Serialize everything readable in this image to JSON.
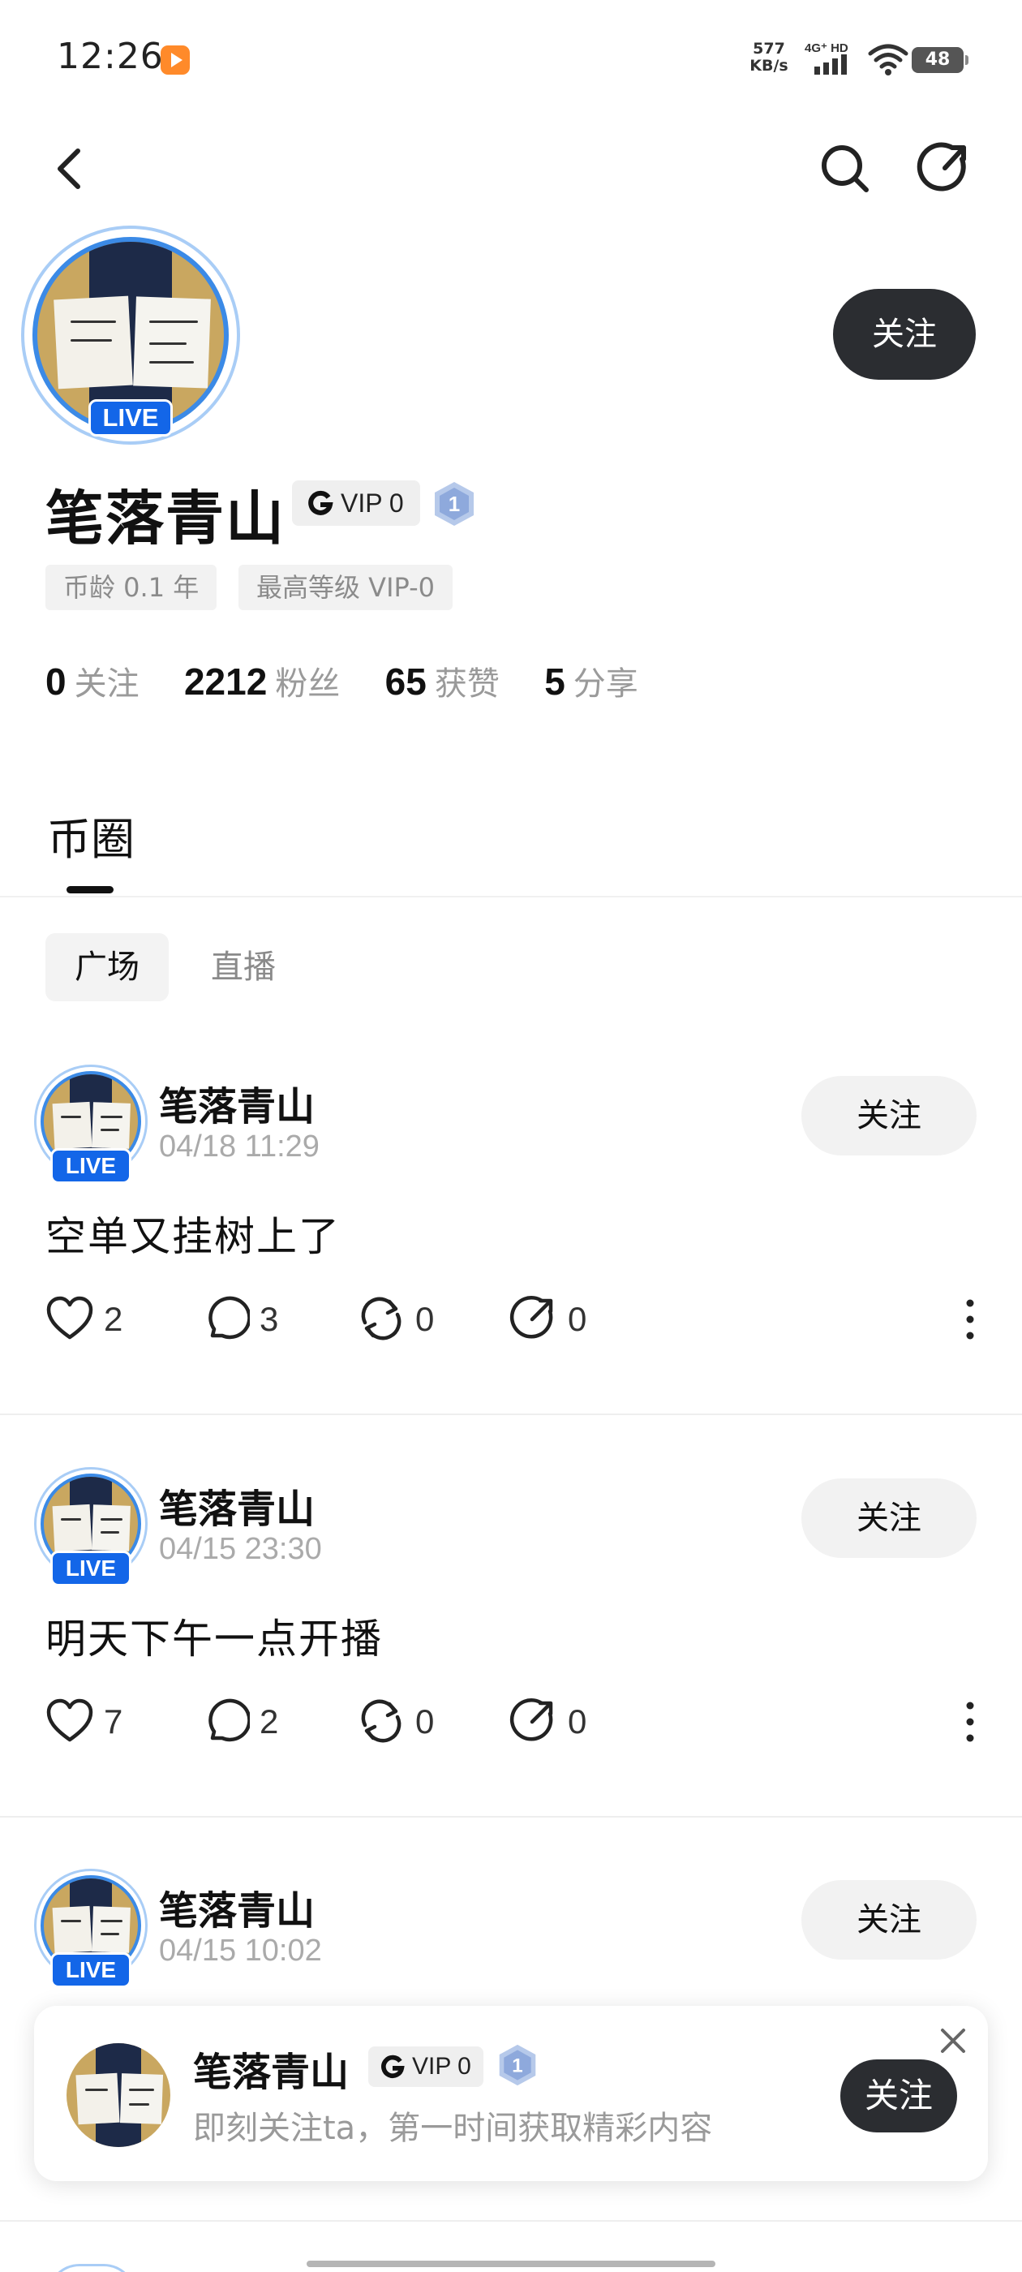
{
  "status_bar": {
    "time": "12:26",
    "net_speed_value": "577",
    "net_speed_unit": "KB/s",
    "network_type": "4G+ HD",
    "battery": "48"
  },
  "top_nav": {
    "back_icon": "chevron-left-icon",
    "search_icon": "search-icon",
    "share_icon": "share-icon"
  },
  "profile": {
    "name": "笔落青山",
    "live_badge": "LIVE",
    "follow_label": "关注",
    "vip_label": "VIP 0",
    "level": "1",
    "tags": [
      "币龄 0.1 年",
      "最高等级 VIP-0"
    ],
    "stats": [
      {
        "value": "0",
        "label": "关注"
      },
      {
        "value": "2212",
        "label": "粉丝"
      },
      {
        "value": "65",
        "label": "获赞"
      },
      {
        "value": "5",
        "label": "分享"
      }
    ]
  },
  "tabs": {
    "main": "币圈",
    "sub": [
      "广场",
      "直播"
    ],
    "sub_selected": "广场"
  },
  "posts": [
    {
      "author": "笔落青山",
      "live_badge": "LIVE",
      "time": "04/18 11:29",
      "follow_label": "关注",
      "text": "空单又挂树上了",
      "likes": "2",
      "comments": "3",
      "reposts": "0",
      "shares": "0"
    },
    {
      "author": "笔落青山",
      "live_badge": "LIVE",
      "time": "04/15 23:30",
      "follow_label": "关注",
      "text": "明天下午一点开播",
      "likes": "7",
      "comments": "2",
      "reposts": "0",
      "shares": "0"
    },
    {
      "author": "笔落青山",
      "live_badge": "LIVE",
      "time": "04/15 10:02",
      "follow_label": "关注"
    }
  ],
  "follow_popup": {
    "name": "笔落青山",
    "vip_label": "VIP 0",
    "level": "1",
    "subtitle": "即刻关注ta，第一时间获取精彩内容",
    "follow_label": "关注",
    "close_icon": "close-icon"
  },
  "colors": {
    "live_blue": "#1366e8",
    "avatar_ring": "#3b8ae6",
    "follow_dark": "#2b2d31",
    "muted_text": "#9a9a9a"
  }
}
